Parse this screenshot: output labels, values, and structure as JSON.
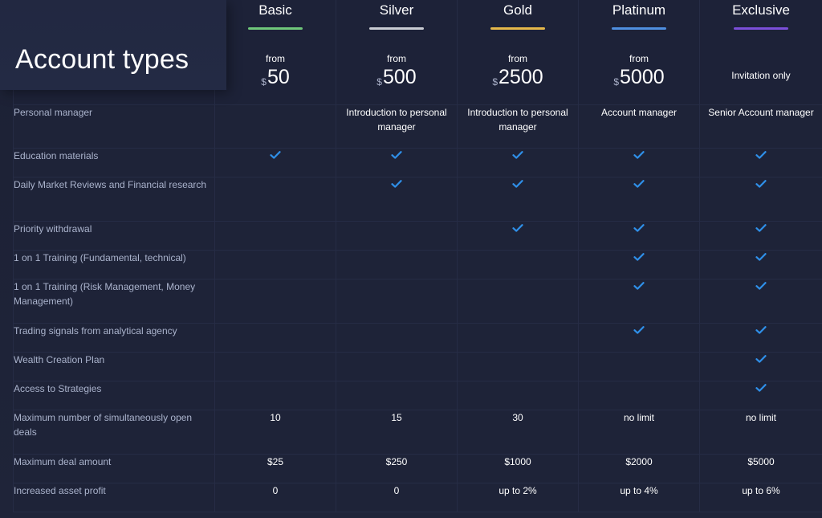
{
  "page": {
    "title": "Account types"
  },
  "colors": {
    "check": "#2f8fe8"
  },
  "plans": [
    {
      "name": "Basic",
      "from_label": "from",
      "currency": "$",
      "price": "50",
      "color": "#6fc77a"
    },
    {
      "name": "Silver",
      "from_label": "from",
      "currency": "$",
      "price": "500",
      "color": "#c9ccd3"
    },
    {
      "name": "Gold",
      "from_label": "from",
      "currency": "$",
      "price": "2500",
      "color": "#e5b84a"
    },
    {
      "name": "Platinum",
      "from_label": "from",
      "currency": "$",
      "price": "5000",
      "color": "#4f8fe0"
    },
    {
      "name": "Exclusive",
      "invite_label": "Invitation only",
      "color": "#7b4fd9"
    }
  ],
  "features": [
    {
      "label": "Personal manager",
      "cells": [
        "",
        "Introduction to personal manager",
        "Introduction to personal manager",
        "Account manager",
        "Senior Account manager"
      ]
    },
    {
      "label": "Education materials",
      "cells": [
        "check",
        "check",
        "check",
        "check",
        "check"
      ]
    },
    {
      "label": "Daily Market Reviews and Financial research",
      "cells": [
        "",
        "check",
        "check",
        "check",
        "check"
      ]
    },
    {
      "label": "Priority withdrawal",
      "cells": [
        "",
        "",
        "check",
        "check",
        "check"
      ]
    },
    {
      "label": "1 on 1 Training (Fundamental, technical)",
      "cells": [
        "",
        "",
        "",
        "check",
        "check"
      ]
    },
    {
      "label": "1 on 1 Training (Risk Management, Money Management)",
      "cells": [
        "",
        "",
        "",
        "check",
        "check"
      ]
    },
    {
      "label": "Trading signals from analytical agency",
      "cells": [
        "",
        "",
        "",
        "check",
        "check"
      ]
    },
    {
      "label": "Wealth Creation Plan",
      "cells": [
        "",
        "",
        "",
        "",
        "check"
      ]
    },
    {
      "label": "Access to Strategies",
      "cells": [
        "",
        "",
        "",
        "",
        "check"
      ]
    },
    {
      "label": "Maximum number of simultaneously open deals",
      "cells": [
        "10",
        "15",
        "30",
        "no limit",
        "no limit"
      ]
    },
    {
      "label": "Maximum deal amount",
      "cells": [
        "$25",
        "$250",
        "$1000",
        "$2000",
        "$5000"
      ]
    },
    {
      "label": "Increased asset profit",
      "cells": [
        "0",
        "0",
        "up to 2%",
        "up to 4%",
        "up to 6%"
      ]
    }
  ]
}
